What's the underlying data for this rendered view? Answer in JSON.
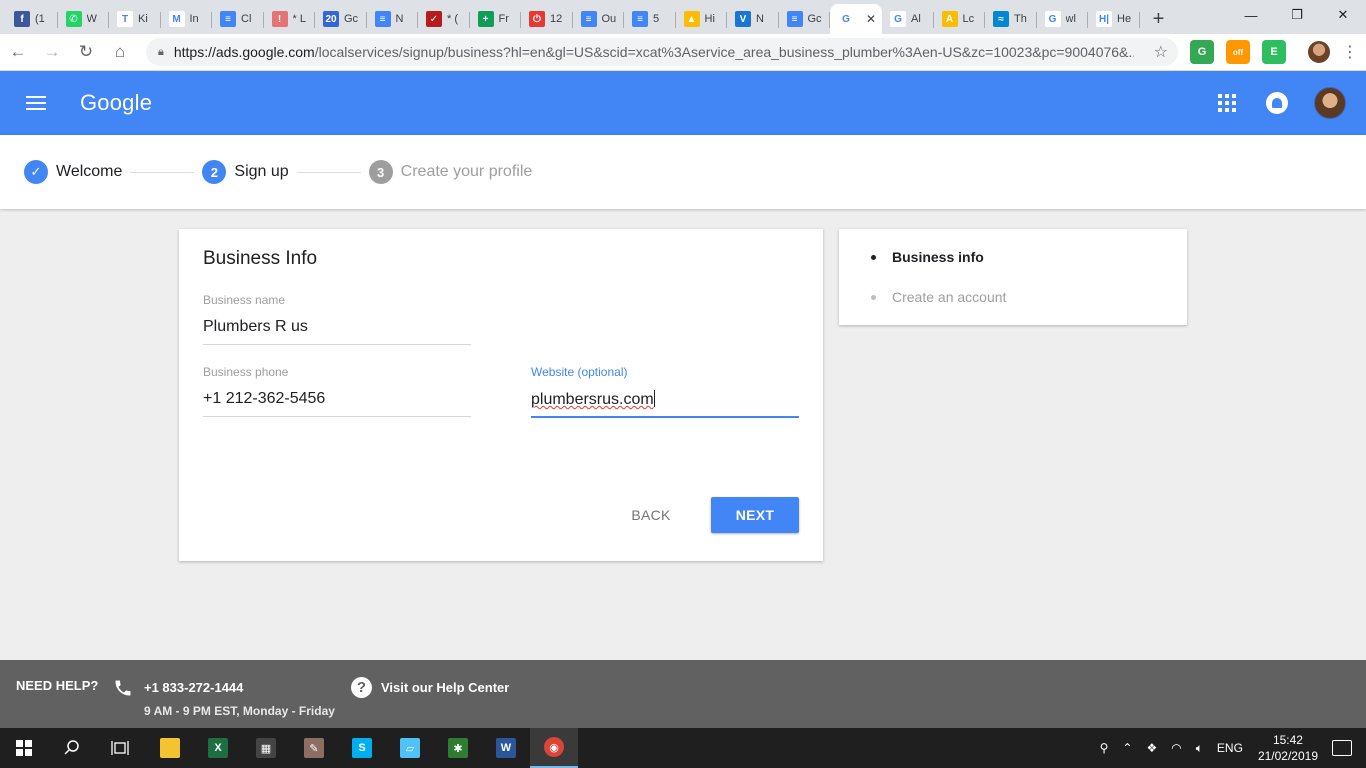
{
  "browser": {
    "tabs": [
      {
        "title": "(1",
        "icon": "facebook-icon",
        "color": "#3b5998",
        "glyph": "f"
      },
      {
        "title": "W",
        "icon": "whatsapp-icon",
        "color": "#25d366",
        "glyph": "✆"
      },
      {
        "title": "Ki",
        "icon": "t-icon",
        "color": "#ffffff",
        "glyph": "T"
      },
      {
        "title": "In",
        "icon": "gmail-icon",
        "color": "#ffffff",
        "glyph": "M"
      },
      {
        "title": "Cl",
        "icon": "docs-icon",
        "color": "#4285f4",
        "glyph": "≡"
      },
      {
        "title": "* L",
        "icon": "badge-icon",
        "color": "#e57373",
        "glyph": "!"
      },
      {
        "title": "Gc",
        "icon": "calendar-icon",
        "color": "#3367d6",
        "glyph": "20"
      },
      {
        "title": "N",
        "icon": "docs-icon",
        "color": "#4285f4",
        "glyph": "≡"
      },
      {
        "title": "* (",
        "icon": "checklist-icon",
        "color": "#b71c1c",
        "glyph": "✓"
      },
      {
        "title": "Fr",
        "icon": "sheets-plus-icon",
        "color": "#0f9d58",
        "glyph": "+"
      },
      {
        "title": "12",
        "icon": "power-icon",
        "color": "#e53935",
        "glyph": "⏻"
      },
      {
        "title": "Ou",
        "icon": "docs-icon",
        "color": "#4285f4",
        "glyph": "≡"
      },
      {
        "title": "5",
        "icon": "docs-icon",
        "color": "#4285f4",
        "glyph": "≡"
      },
      {
        "title": "Hi",
        "icon": "drive-icon",
        "color": "#fbbc04",
        "glyph": "▲"
      },
      {
        "title": "N",
        "icon": "v-icon",
        "color": "#1976d2",
        "glyph": "V"
      },
      {
        "title": "Gc",
        "icon": "docs-icon",
        "color": "#4285f4",
        "glyph": "≡"
      },
      {
        "title": "",
        "icon": "google-icon",
        "color": "#ffffff",
        "glyph": "G",
        "active": true
      },
      {
        "title": "Al",
        "icon": "google-icon",
        "color": "#ffffff",
        "glyph": "G"
      },
      {
        "title": "Lc",
        "icon": "google-ads-icon",
        "color": "#fbbc04",
        "glyph": "A"
      },
      {
        "title": "Th",
        "icon": "wave-icon",
        "color": "#0288d1",
        "glyph": "≈"
      },
      {
        "title": "wl",
        "icon": "google-icon",
        "color": "#ffffff",
        "glyph": "G"
      },
      {
        "title": "He",
        "icon": "h-icon",
        "color": "#ffffff",
        "glyph": "H|"
      }
    ],
    "url_host": "https://ads.google.com",
    "url_path": "/localservices/signup/business?hl=en&gl=US&scid=xcat%3Aservice_area_business_plumber%3Aen-US&zc=10023&pc=9004076&...",
    "extensions": [
      {
        "icon": "ext-maps-icon",
        "color": "#34a853",
        "glyph": "G"
      },
      {
        "icon": "ext-off-icon",
        "color": "#ff9800",
        "glyph": "off"
      },
      {
        "icon": "evernote-icon",
        "color": "#2dbe60",
        "glyph": "E"
      }
    ]
  },
  "app": {
    "logo": "Google",
    "accent": "#4285f4"
  },
  "stepper": {
    "steps": [
      {
        "number": "✓",
        "label": "Welcome",
        "state": "done"
      },
      {
        "number": "2",
        "label": "Sign up",
        "state": "current"
      },
      {
        "number": "3",
        "label": "Create your profile",
        "state": "future"
      }
    ]
  },
  "form": {
    "title": "Business Info",
    "business_name_label": "Business name",
    "business_name_value": "Plumbers R us",
    "business_phone_label": "Business phone",
    "business_phone_value": "+1 212-362-5456",
    "website_label": "Website (optional)",
    "website_value": "plumbersrus.com",
    "back_label": "BACK",
    "next_label": "NEXT"
  },
  "side_nav": {
    "items": [
      {
        "label": "Business info",
        "active": true
      },
      {
        "label": "Create an account",
        "active": false
      }
    ]
  },
  "footer": {
    "need_help": "NEED HELP?",
    "phone": "+1 833-272-1444",
    "hours": "9 AM - 9 PM EST, Monday - Friday",
    "help_center": "Visit our Help Center"
  },
  "taskbar": {
    "apps": [
      {
        "icon": "file-explorer-icon",
        "color": "#f4c430",
        "glyph": ""
      },
      {
        "icon": "excel-icon",
        "color": "#1d6f42",
        "glyph": "X"
      },
      {
        "icon": "calculator-icon",
        "color": "#444444",
        "glyph": "▦"
      },
      {
        "icon": "paint-icon",
        "color": "#8d6e63",
        "glyph": "✎"
      },
      {
        "icon": "skype-icon",
        "color": "#00aff0",
        "glyph": "S"
      },
      {
        "icon": "notes-icon",
        "color": "#4fc3f7",
        "glyph": "▱"
      },
      {
        "icon": "network-app-icon",
        "color": "#2e7d32",
        "glyph": "✱"
      },
      {
        "icon": "word-icon",
        "color": "#2b579a",
        "glyph": "W"
      },
      {
        "icon": "chrome-icon",
        "color": "#db4437",
        "glyph": "◉",
        "active": true
      }
    ],
    "language": "ENG",
    "time": "15:42",
    "date": "21/02/2019"
  }
}
